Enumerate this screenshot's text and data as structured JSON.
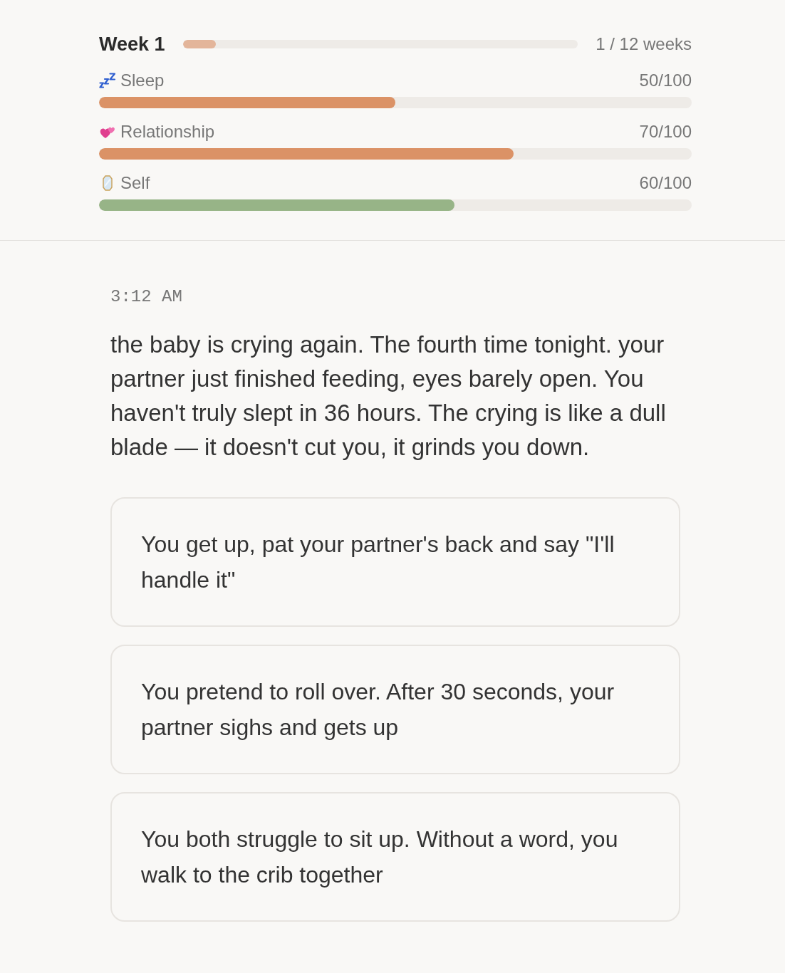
{
  "header": {
    "week_label": "Week 1",
    "week_progress": {
      "level": 0.083
    },
    "week_count": "1 / 12 weeks"
  },
  "stats": [
    {
      "kind": "sleep",
      "label": "Sleep",
      "value": "50/100",
      "level": 0.5,
      "color": "#db9266"
    },
    {
      "kind": "relationship",
      "label": "Relationship",
      "value": "70/100",
      "level": 0.7,
      "color": "#db9266"
    },
    {
      "kind": "self",
      "label": "Self",
      "value": "60/100",
      "level": 0.6,
      "color": "#97b487"
    }
  ],
  "scene": {
    "time": "3:12 AM",
    "text": "the baby is crying again. The fourth time tonight. your partner just finished feeding, eyes barely open. You haven't truly slept in 36 hours. The crying is like a dull blade — it doesn't cut you, it grinds you down."
  },
  "choices": [
    {
      "text": "You get up, pat your partner's back and say \"I'll handle it\""
    },
    {
      "text": "You pretend to roll over. After 30 seconds, your partner sighs and gets up"
    },
    {
      "text": "You both struggle to sit up. Without a word, you walk to the crib together"
    }
  ]
}
